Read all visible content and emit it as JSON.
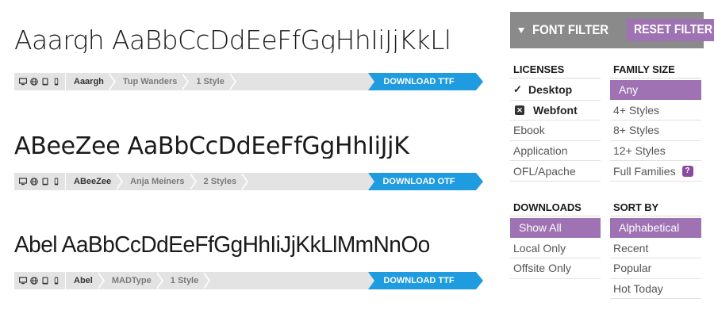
{
  "fonts": [
    {
      "sample": "Aaargh AaBbCcDdEeFfGgHhIiJjKkLl",
      "name": "Aaargh",
      "designer": "Tup Wanders",
      "styles": "1 Style",
      "download": "DOWNLOAD TTF"
    },
    {
      "sample": "ABeeZee AaBbCcDdEeFfGgHhIiJjK",
      "name": "ABeeZee",
      "designer": "Anja Meiners",
      "styles": "2 Styles",
      "download": "DOWNLOAD OTF"
    },
    {
      "sample": "Abel AaBbCcDdEeFfGgHhIiJjKkLlMmNnOo",
      "name": "Abel",
      "designer": "MADType",
      "styles": "1 Style",
      "download": "DOWNLOAD TTF"
    }
  ],
  "device_icons": [
    "desktop-icon",
    "globe-icon",
    "tablet-icon",
    "phone-icon"
  ],
  "filter": {
    "title": "FONT FILTER",
    "reset": "RESET FILTER",
    "licenses": {
      "heading": "LICENSES",
      "items": [
        "Desktop",
        "Webfont",
        "Ebook",
        "Application",
        "OFL/Apache"
      ]
    },
    "family_size": {
      "heading": "FAMILY SIZE",
      "items": [
        "Any",
        "4+ Styles",
        "8+ Styles",
        "12+ Styles",
        "Full Families"
      ]
    },
    "downloads": {
      "heading": "DOWNLOADS",
      "items": [
        "Show All",
        "Local Only",
        "Offsite Only"
      ]
    },
    "sort_by": {
      "heading": "SORT BY",
      "items": [
        "Alphabetical",
        "Recent",
        "Popular",
        "Hot Today"
      ]
    }
  },
  "colors": {
    "accent": "#9e72b3",
    "download": "#1f9ce0",
    "header": "#8a8a8a",
    "bar": "#e3e3e3"
  }
}
